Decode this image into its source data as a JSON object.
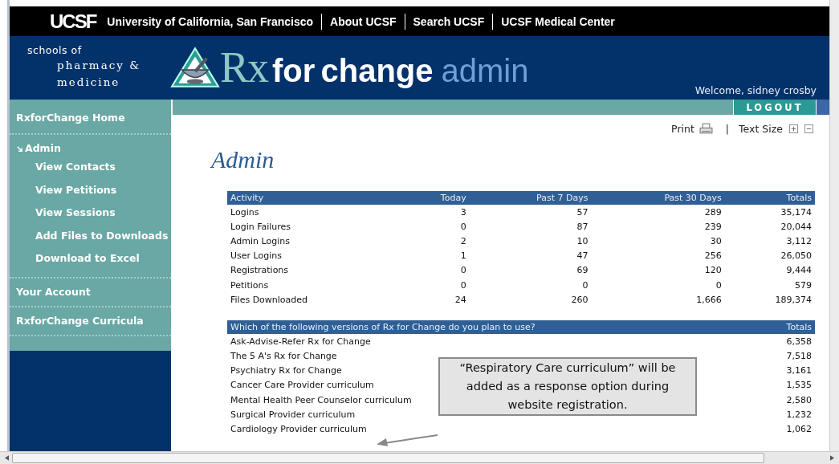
{
  "topbar": {
    "logo": "UCSF",
    "links": [
      "University of California, San Francisco",
      "About UCSF",
      "Search UCSF",
      "UCSF Medical Center"
    ]
  },
  "header": {
    "schools": [
      "schools of",
      "pharmacy &",
      "medicine"
    ],
    "brand": {
      "rx": "Rx",
      "for_change": "for change",
      "admin": "admin"
    },
    "welcome": "Welcome, sidney crosby",
    "logout": "LOGOUT"
  },
  "sidebar": {
    "items": [
      {
        "label": "RxforChange Home",
        "expanded": false
      },
      {
        "label": "Admin",
        "expanded": true,
        "children": [
          {
            "label": "View Contacts"
          },
          {
            "label": "View Petitions"
          },
          {
            "label": "View Sessions"
          },
          {
            "label": "Add Files to Downloads"
          },
          {
            "label": "Download to Excel"
          }
        ]
      },
      {
        "label": "Your Account",
        "expanded": false
      },
      {
        "label": "RxforChange Curricula",
        "expanded": false
      }
    ]
  },
  "tools": {
    "print": "Print",
    "separator": "|",
    "text_size": "Text Size"
  },
  "page_title": "Admin",
  "activity_table": {
    "columns": [
      "Activity",
      "Today",
      "Past 7 Days",
      "Past 30 Days",
      "Totals"
    ],
    "rows": [
      [
        "Logins",
        "3",
        "57",
        "289",
        "35,174"
      ],
      [
        "Login Failures",
        "0",
        "87",
        "239",
        "20,044"
      ],
      [
        "Admin Logins",
        "2",
        "10",
        "30",
        "3,112"
      ],
      [
        "User Logins",
        "1",
        "47",
        "256",
        "26,050"
      ],
      [
        "Registrations",
        "0",
        "69",
        "120",
        "9,444"
      ],
      [
        "Petitions",
        "0",
        "0",
        "0",
        "579"
      ],
      [
        "Files Downloaded",
        "24",
        "260",
        "1,666",
        "189,374"
      ]
    ]
  },
  "versions_table": {
    "columns": [
      "Which of the following versions of Rx for Change do you plan to use?",
      "Totals"
    ],
    "rows": [
      [
        "Ask-Advise-Refer Rx for Change",
        "6,358"
      ],
      [
        "The 5 A's Rx for Change",
        "7,518"
      ],
      [
        "Psychiatry Rx for Change",
        "3,161"
      ],
      [
        "Cancer Care Provider curriculum",
        "1,535"
      ],
      [
        "Mental Health Peer Counselor curriculum",
        "2,580"
      ],
      [
        "Surgical Provider curriculum",
        "1,232"
      ],
      [
        "Cardiology Provider curriculum",
        "1,062"
      ]
    ]
  },
  "callout": {
    "text": "“Respiratory Care curriculum” will be added as a response option during website registration."
  }
}
